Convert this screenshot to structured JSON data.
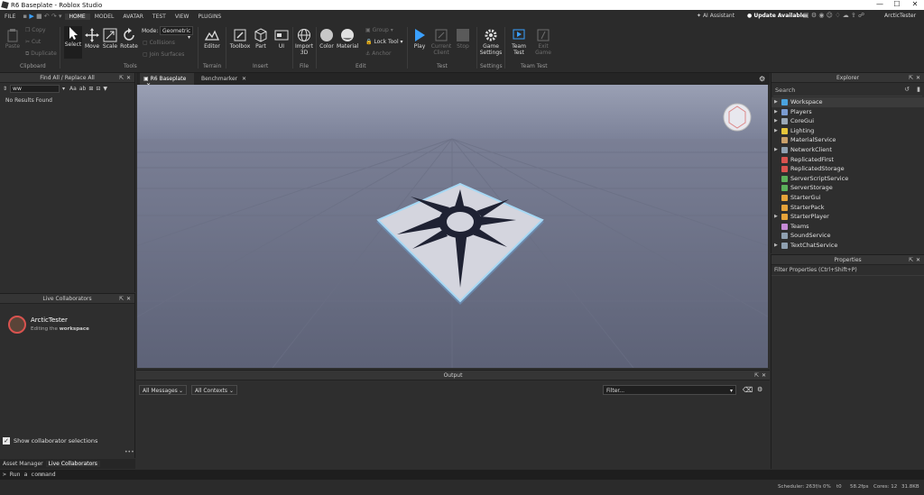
{
  "window": {
    "title": "R6 Baseplate - Roblox Studio",
    "controls": [
      "—",
      "☐",
      "✕"
    ]
  },
  "menu": {
    "items": [
      "FILE",
      "HOME",
      "MODEL",
      "AVATAR",
      "TEST",
      "VIEW",
      "PLUGINS"
    ],
    "active": "HOME",
    "right": {
      "ai": "AI Assistant",
      "update": "Update Available",
      "user": "ArcticTester"
    }
  },
  "ribbon": {
    "clipboard": {
      "paste": "Paste",
      "copy": "Copy",
      "cut": "Cut",
      "duplicate": "Duplicate",
      "group_label": "Clipboard"
    },
    "tools": {
      "select": "Select",
      "move": "Move",
      "scale": "Scale",
      "rotate": "Rotate",
      "mode_label": "Mode:",
      "mode_value": "Geometric",
      "collisions": "Collisions",
      "join": "Join Surfaces",
      "group_label": "Tools"
    },
    "terrain": {
      "editor": "Editor",
      "group_label": "Terrain"
    },
    "insert": {
      "toolbox": "Toolbox",
      "part": "Part",
      "ui": "UI",
      "group_label": "Insert"
    },
    "file": {
      "import": "Import",
      "import2": "3D",
      "group_label": "File"
    },
    "edit": {
      "color": "Color",
      "material": "Material",
      "group": "Group",
      "lock": "Lock Tool",
      "anchor": "Anchor",
      "group_label": "Edit"
    },
    "test": {
      "play": "Play",
      "current": "Current",
      "client": "Client",
      "stop": "Stop",
      "group_label": "Test"
    },
    "settings": {
      "game": "Game",
      "settings": "Settings",
      "group_label": "Settings"
    },
    "team": {
      "team": "Team",
      "test": "Test",
      "exit": "Exit",
      "game": "Game",
      "group_label": "Team Test"
    }
  },
  "find": {
    "title": "Find All / Replace All",
    "query": "ww",
    "result": "No Results Found",
    "opts": [
      "Aa",
      "ab"
    ]
  },
  "collab": {
    "title": "Live Collaborators",
    "name": "ArcticTester",
    "status_pre": "Editing the ",
    "status_obj": "workspace",
    "checkbox": "Show collaborator selections"
  },
  "bottom_tabs": [
    "Asset Manager",
    "Live Collaborators"
  ],
  "doc_tabs": [
    "R6 Baseplate",
    "Benchmarker"
  ],
  "explorer": {
    "title": "Explorer",
    "search_placeholder": "Search",
    "items": [
      {
        "name": "Workspace",
        "icon": "globe-icon",
        "color": "#4aa3df",
        "arrow": true
      },
      {
        "name": "Players",
        "icon": "players-icon",
        "color": "#7a9bd1",
        "arrow": true
      },
      {
        "name": "CoreGui",
        "icon": "gui-icon",
        "color": "#9aa7b5",
        "arrow": true
      },
      {
        "name": "Lighting",
        "icon": "lightbulb-icon",
        "color": "#e6c53a",
        "arrow": true
      },
      {
        "name": "MaterialService",
        "icon": "material-icon",
        "color": "#c9a06a",
        "arrow": false
      },
      {
        "name": "NetworkClient",
        "icon": "network-icon",
        "color": "#8fa0b0",
        "arrow": true
      },
      {
        "name": "ReplicatedFirst",
        "icon": "replicated-icon",
        "color": "#d9534f",
        "arrow": false
      },
      {
        "name": "ReplicatedStorage",
        "icon": "storage-icon",
        "color": "#d9534f",
        "arrow": false
      },
      {
        "name": "ServerScriptService",
        "icon": "script-service-icon",
        "color": "#5bb05b",
        "arrow": false
      },
      {
        "name": "ServerStorage",
        "icon": "server-storage-icon",
        "color": "#5bb05b",
        "arrow": false
      },
      {
        "name": "StarterGui",
        "icon": "starter-gui-icon",
        "color": "#e6a33a",
        "arrow": false
      },
      {
        "name": "StarterPack",
        "icon": "starter-pack-icon",
        "color": "#e6a33a",
        "arrow": false
      },
      {
        "name": "StarterPlayer",
        "icon": "starter-player-icon",
        "color": "#e6a33a",
        "arrow": true
      },
      {
        "name": "Teams",
        "icon": "teams-icon",
        "color": "#c58ad6",
        "arrow": false
      },
      {
        "name": "SoundService",
        "icon": "sound-icon",
        "color": "#8fa0b0",
        "arrow": false
      },
      {
        "name": "TextChatService",
        "icon": "chat-icon",
        "color": "#8fa0b0",
        "arrow": true
      }
    ]
  },
  "properties": {
    "title": "Properties",
    "filter": "Filter Properties (Ctrl+Shift+P)"
  },
  "output": {
    "title": "Output",
    "messages": "All Messages",
    "contexts": "All Contexts",
    "filter": "Filter..."
  },
  "command": {
    "placeholder": "Run a command"
  },
  "status": {
    "scheduler": "Scheduler: 263f/s 0%",
    "t0": "t0",
    "fps": "58.2fps",
    "cores": "Cores: 12",
    "mem": "31.8KB"
  }
}
